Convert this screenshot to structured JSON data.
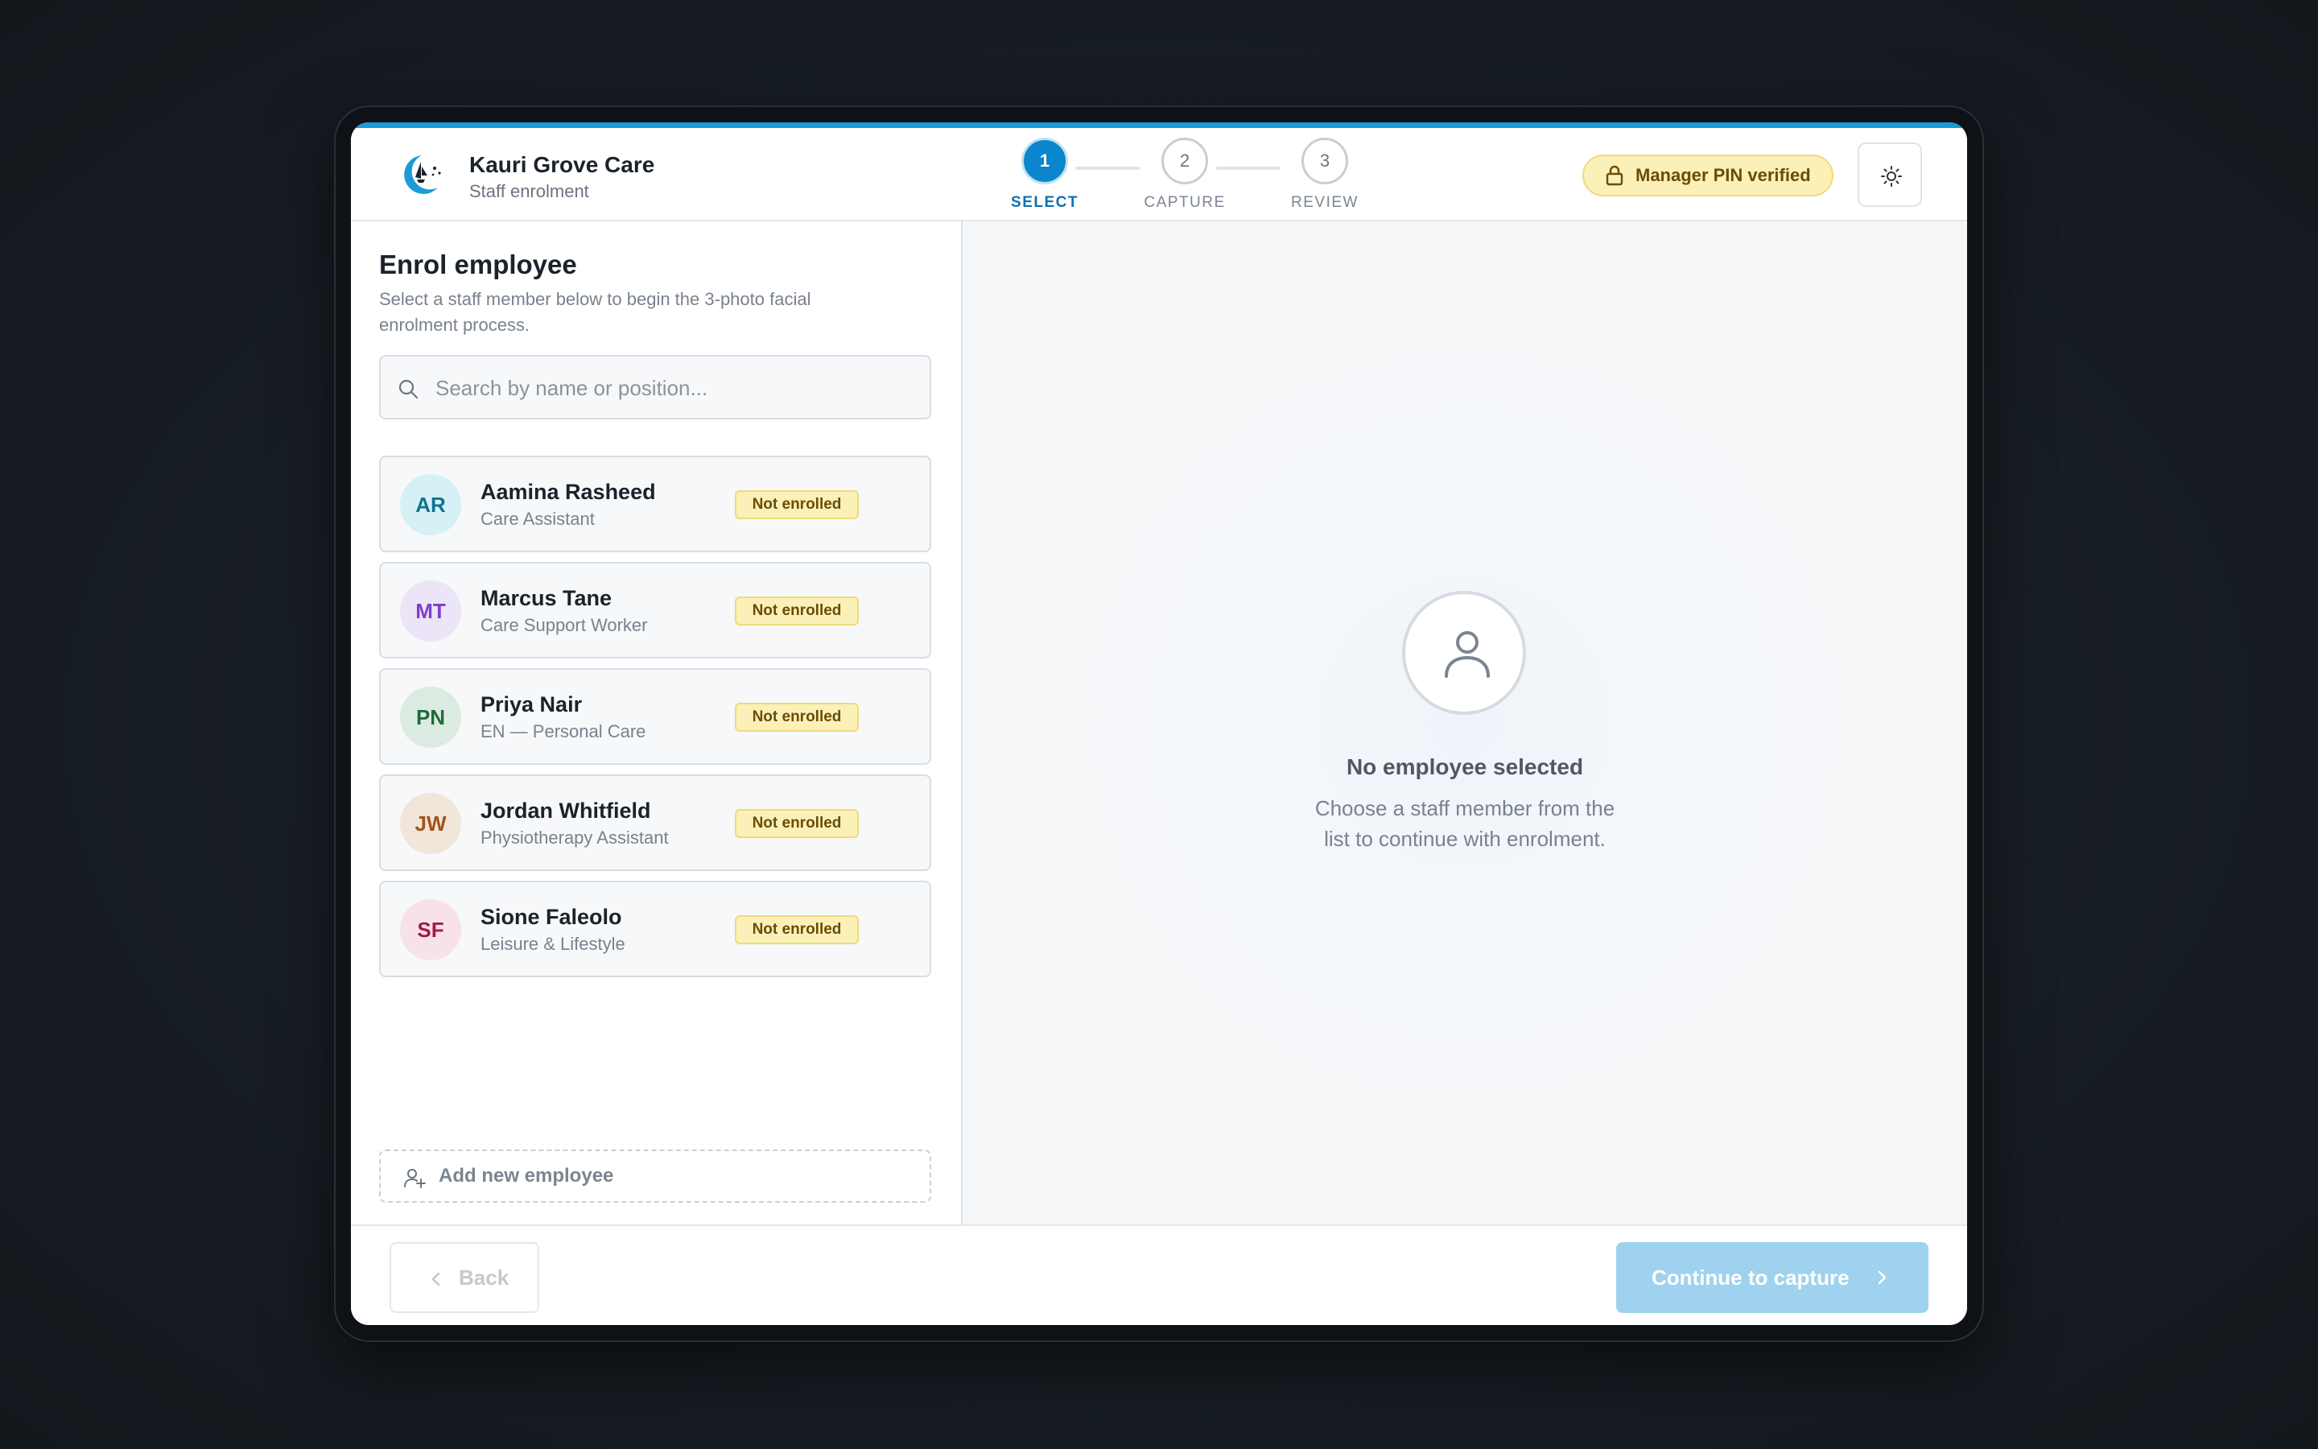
{
  "brand": {
    "name": "Kauri Grove Care",
    "subtitle": "Staff enrolment"
  },
  "stepper": {
    "steps": [
      {
        "number": "1",
        "label": "SELECT",
        "active": true
      },
      {
        "number": "2",
        "label": "CAPTURE",
        "active": false
      },
      {
        "number": "3",
        "label": "REVIEW",
        "active": false
      }
    ]
  },
  "header": {
    "pin_badge": "Manager PIN verified",
    "theme_toggle_icon": "sun-icon"
  },
  "left_panel": {
    "title": "Enrol employee",
    "description": "Select a staff member below to begin the 3-photo facial enrolment process.",
    "search": {
      "placeholder": "Search by name or position...",
      "value": ""
    },
    "employees": [
      {
        "initials": "AR",
        "name": "Aamina Rasheed",
        "role": "Care Assistant",
        "status": "Not enrolled",
        "avatar_bg": "#d6f1f5",
        "avatar_fg": "#0e7490"
      },
      {
        "initials": "MT",
        "name": "Marcus Tane",
        "role": "Care Support Worker",
        "status": "Not enrolled",
        "avatar_bg": "#ece4f7",
        "avatar_fg": "#7e3fc8"
      },
      {
        "initials": "PN",
        "name": "Priya Nair",
        "role": "EN — Personal Care",
        "status": "Not enrolled",
        "avatar_bg": "#dcebe1",
        "avatar_fg": "#1e6b3a"
      },
      {
        "initials": "JW",
        "name": "Jordan Whitfield",
        "role": "Physiotherapy Assistant",
        "status": "Not enrolled",
        "avatar_bg": "#f1e6da",
        "avatar_fg": "#a5521b"
      },
      {
        "initials": "SF",
        "name": "Sione Faleolo",
        "role": "Leisure & Lifestyle",
        "status": "Not enrolled",
        "avatar_bg": "#f8e2ea",
        "avatar_fg": "#a3194f"
      }
    ],
    "add_button": "Add new employee"
  },
  "right_panel": {
    "empty_title": "No employee selected",
    "empty_subtitle": "Choose a staff member from the list to continue with enrolment."
  },
  "footer": {
    "back_label": "Back",
    "continue_label": "Continue to capture"
  },
  "colors": {
    "accent": "#0b86cc",
    "badge_bg": "#fbf0b8",
    "badge_text": "#6a4d05",
    "continue_disabled": "#9fd2ee"
  }
}
